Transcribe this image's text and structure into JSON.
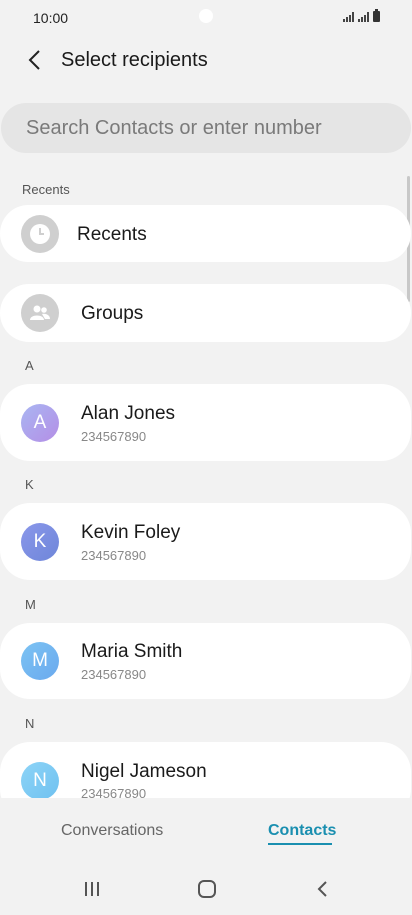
{
  "status": {
    "time": "10:00"
  },
  "header": {
    "title": "Select recipients"
  },
  "search": {
    "placeholder": "Search Contacts or enter number"
  },
  "recents_section": {
    "label": "Recents"
  },
  "recents_item": {
    "label": "Recents",
    "icon": "clock-icon"
  },
  "groups_item": {
    "label": "Groups",
    "icon": "people-icon"
  },
  "contacts": [
    {
      "letter": "A",
      "name": "Alan Jones",
      "number": "234567890",
      "initial": "A",
      "color_from": "#a9b6f2",
      "color_to": "#b48ee6"
    },
    {
      "letter": "K",
      "name": "Kevin Foley",
      "number": "234567890",
      "initial": "K",
      "color_from": "#8a97ea",
      "color_to": "#6e86d9"
    },
    {
      "letter": "M",
      "name": "Maria Smith",
      "number": "234567890",
      "initial": "M",
      "color_from": "#7cc3f3",
      "color_to": "#6aa9ee"
    },
    {
      "letter": "N",
      "name": "Nigel Jameson",
      "number": "234567890",
      "initial": "N",
      "color_from": "#8dd4f7",
      "color_to": "#6fc1f0"
    }
  ],
  "tabs": {
    "conversations": "Conversations",
    "contacts": "Contacts"
  },
  "colors": {
    "accent": "#1a8fb0",
    "background": "#f2f2f2",
    "card": "#ffffff"
  }
}
